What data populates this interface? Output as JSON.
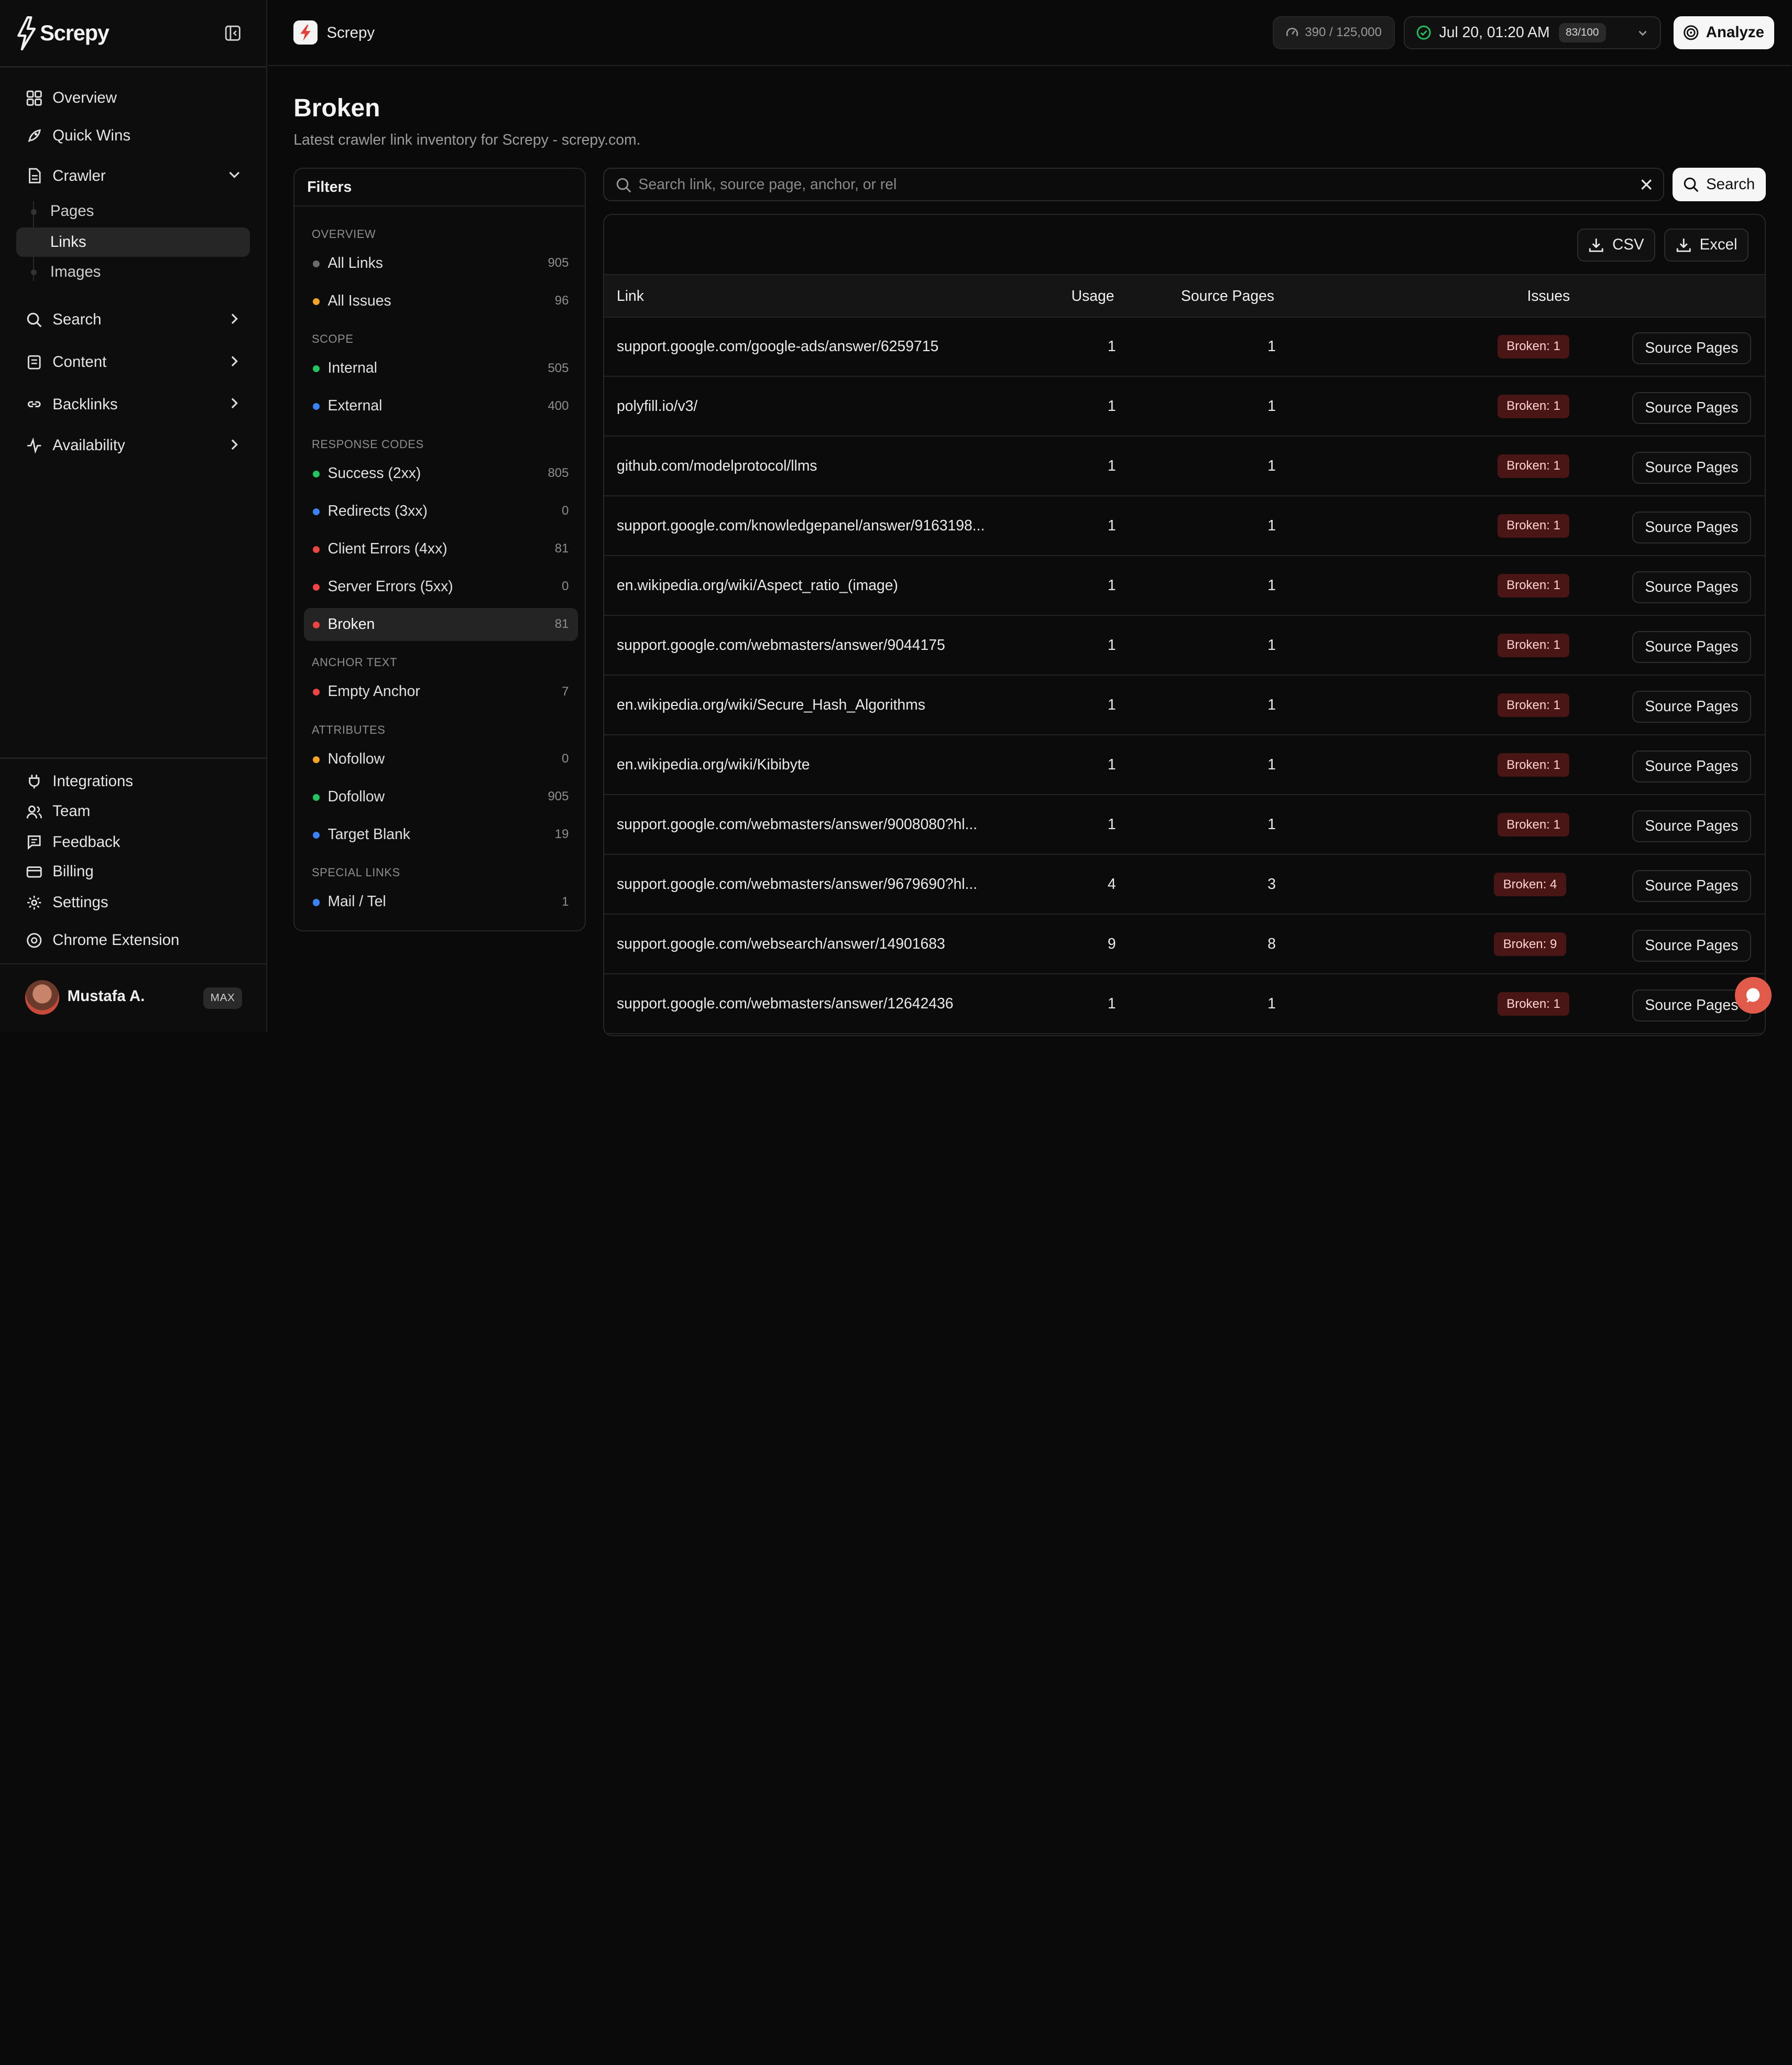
{
  "brand": {
    "name": "Screpy"
  },
  "sidebar": {
    "nav": [
      {
        "label": "Overview",
        "icon": "grid-icon"
      },
      {
        "label": "Quick Wins",
        "icon": "rocket-icon"
      },
      {
        "label": "Crawler",
        "icon": "document-icon"
      },
      {
        "label": "Search",
        "icon": "search-icon"
      },
      {
        "label": "Content",
        "icon": "newspaper-icon"
      },
      {
        "label": "Backlinks",
        "icon": "link-icon"
      },
      {
        "label": "Availability",
        "icon": "activity-icon"
      }
    ],
    "crawler_sub": [
      {
        "label": "Pages"
      },
      {
        "label": "Links"
      },
      {
        "label": "Images"
      }
    ],
    "bottom": [
      {
        "label": "Integrations",
        "icon": "plug-icon"
      },
      {
        "label": "Team",
        "icon": "users-icon"
      },
      {
        "label": "Feedback",
        "icon": "message-icon"
      },
      {
        "label": "Billing",
        "icon": "credit-card-icon"
      },
      {
        "label": "Settings",
        "icon": "gear-icon"
      }
    ],
    "chrome_extension": "Chrome Extension",
    "user": {
      "name": "Mustafa A.",
      "plan": "MAX"
    }
  },
  "topbar": {
    "project": "Screpy",
    "credits": "390 / 125,000",
    "crawl_date": "Jul 20, 01:20 AM",
    "crawl_score": "83/100",
    "analyze_label": "Analyze"
  },
  "header": {
    "title": "Broken",
    "subtitle": "Latest crawler link inventory for Screpy - screpy.com."
  },
  "filters": {
    "title": "Filters",
    "sections": [
      {
        "title": "OVERVIEW",
        "items": [
          {
            "label": "All Links",
            "count": "905",
            "color": "#6b6b6b"
          },
          {
            "label": "All Issues",
            "count": "96",
            "color": "#f5a524"
          }
        ]
      },
      {
        "title": "SCOPE",
        "items": [
          {
            "label": "Internal",
            "count": "505",
            "color": "#22c55e"
          },
          {
            "label": "External",
            "count": "400",
            "color": "#3b82f6"
          }
        ]
      },
      {
        "title": "RESPONSE CODES",
        "items": [
          {
            "label": "Success (2xx)",
            "count": "805",
            "color": "#22c55e"
          },
          {
            "label": "Redirects (3xx)",
            "count": "0",
            "color": "#3b82f6"
          },
          {
            "label": "Client Errors (4xx)",
            "count": "81",
            "color": "#ef4444"
          },
          {
            "label": "Server Errors (5xx)",
            "count": "0",
            "color": "#ef4444"
          },
          {
            "label": "Broken",
            "count": "81",
            "color": "#ef4444"
          }
        ]
      },
      {
        "title": "ANCHOR TEXT",
        "items": [
          {
            "label": "Empty Anchor",
            "count": "7",
            "color": "#ef4444"
          }
        ]
      },
      {
        "title": "ATTRIBUTES",
        "items": [
          {
            "label": "Nofollow",
            "count": "0",
            "color": "#f5a524"
          },
          {
            "label": "Dofollow",
            "count": "905",
            "color": "#22c55e"
          },
          {
            "label": "Target Blank",
            "count": "19",
            "color": "#3b82f6"
          }
        ]
      },
      {
        "title": "SPECIAL LINKS",
        "items": [
          {
            "label": "Mail / Tel",
            "count": "1",
            "color": "#3b82f6"
          }
        ]
      }
    ]
  },
  "search": {
    "placeholder": "Search link, source page, anchor, or rel",
    "button_label": "Search"
  },
  "export": {
    "csv_label": "CSV",
    "excel_label": "Excel"
  },
  "table": {
    "columns": {
      "link": "Link",
      "usage": "Usage",
      "source_pages": "Source Pages",
      "issues": "Issues"
    },
    "action_label": "Source Pages",
    "rows": [
      {
        "link": "support.google.com/google-ads/answer/6259715",
        "usage": "1",
        "source_pages": "1",
        "issue": "Broken: 1"
      },
      {
        "link": "polyfill.io/v3/",
        "usage": "1",
        "source_pages": "1",
        "issue": "Broken: 1"
      },
      {
        "link": "github.com/modelprotocol/llms",
        "usage": "1",
        "source_pages": "1",
        "issue": "Broken: 1"
      },
      {
        "link": "support.google.com/knowledgepanel/answer/9163198...",
        "usage": "1",
        "source_pages": "1",
        "issue": "Broken: 1"
      },
      {
        "link": "en.wikipedia.org/wiki/Aspect_ratio_(image)",
        "usage": "1",
        "source_pages": "1",
        "issue": "Broken: 1"
      },
      {
        "link": "support.google.com/webmasters/answer/9044175",
        "usage": "1",
        "source_pages": "1",
        "issue": "Broken: 1"
      },
      {
        "link": "en.wikipedia.org/wiki/Secure_Hash_Algorithms",
        "usage": "1",
        "source_pages": "1",
        "issue": "Broken: 1"
      },
      {
        "link": "en.wikipedia.org/wiki/Kibibyte",
        "usage": "1",
        "source_pages": "1",
        "issue": "Broken: 1"
      },
      {
        "link": "support.google.com/webmasters/answer/9008080?hl...",
        "usage": "1",
        "source_pages": "1",
        "issue": "Broken: 1"
      },
      {
        "link": "support.google.com/webmasters/answer/9679690?hl...",
        "usage": "4",
        "source_pages": "3",
        "issue": "Broken: 4"
      },
      {
        "link": "support.google.com/websearch/answer/14901683",
        "usage": "9",
        "source_pages": "8",
        "issue": "Broken: 9"
      },
      {
        "link": "support.google.com/webmasters/answer/12642436",
        "usage": "1",
        "source_pages": "1",
        "issue": "Broken: 1"
      }
    ]
  }
}
